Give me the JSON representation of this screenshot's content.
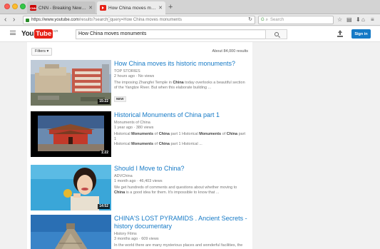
{
  "browser": {
    "tabs": [
      {
        "favicon": "cnn-icon",
        "favicon_text": "CNN",
        "title": "CNN - Breaking News, U.S., ...",
        "active": false
      },
      {
        "favicon": "youtube-icon",
        "title": "How China moves monume...",
        "active": true
      }
    ],
    "url_host": "https://www.youtube.com",
    "url_path": "/results?search_query=How China moves monuments",
    "search_placeholder": "Search"
  },
  "youtube": {
    "logo_you": "You",
    "logo_tube": "Tube",
    "logo_country": "KR",
    "search_value": "How China moves monuments",
    "signin_label": "Sign in",
    "brand_color": "#e62117",
    "link_color": "#167ac6"
  },
  "results": {
    "filters_label": "Filters",
    "count_text": "About 84,000 results",
    "items": [
      {
        "title": "How China moves its historic monuments?",
        "channel": "TOP STORIES",
        "meta": "2 hours ago · No views",
        "desc_parts": [
          "The imposing Zhangfei Temple in ",
          "China",
          " today overlooks a beautiful section of the Yangtze River. But when this elaborate building ..."
        ],
        "badge": "NEW",
        "duration": "15:22"
      },
      {
        "title": "Historical Monuments of China part 1",
        "channel": "Monuments of China",
        "meta": "1 year ago · 380 views",
        "desc_line1": [
          "Historical ",
          "Monuments",
          " of ",
          "China",
          " part 1 Historical ",
          "Monuments",
          " of ",
          "China",
          " part 1"
        ],
        "desc_line2": [
          "Historical ",
          "Monuments",
          " of ",
          "China",
          " part 1 Historical ..."
        ],
        "duration": "1:22"
      },
      {
        "title": "Should I Move to China?",
        "channel": "ADVChina",
        "meta": "1 month ago · 46,403 views",
        "desc_parts": [
          "We get hundreds of comments and questions about whether moving to ",
          "China",
          " is a good idea for them. It's impossible to know that ..."
        ],
        "duration": "14:52"
      },
      {
        "title": "CHINA'S LOST PYRAMIDS . Ancient Secrets - history documentary",
        "channel": "History Films",
        "meta": "3 months ago · 609 views",
        "desc_parts": [
          "In the world there are many mysterious places and wonderful facilities, the"
        ]
      }
    ]
  }
}
